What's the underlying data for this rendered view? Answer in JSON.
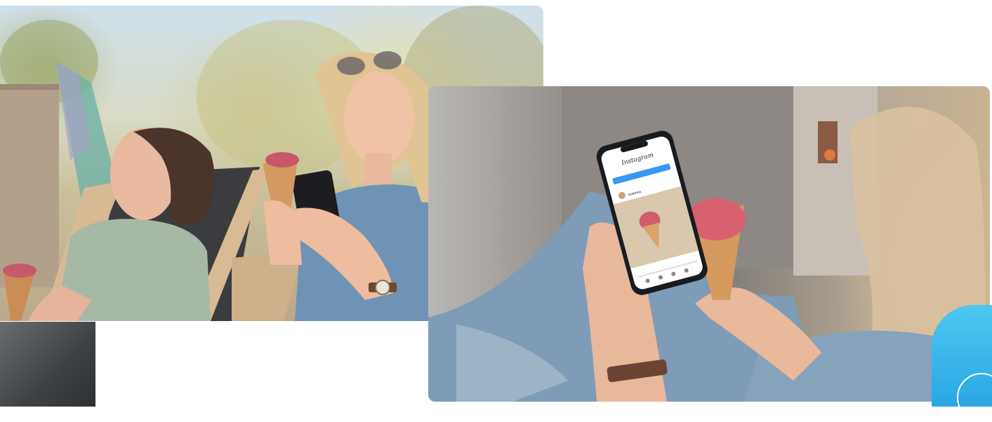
{
  "photos": {
    "main": {
      "subject": "photo-deckchairs"
    },
    "detail": {
      "subject": "photo-phone-closeup"
    },
    "corner": {
      "subject": "photo-corner-crop"
    }
  },
  "phone_screen": {
    "app_logo": "Instagram",
    "account_name": "Kathrina"
  },
  "colors": {
    "accent": "#3fb6ec",
    "background": "#ffffff",
    "phone_button": "#3897f0"
  }
}
